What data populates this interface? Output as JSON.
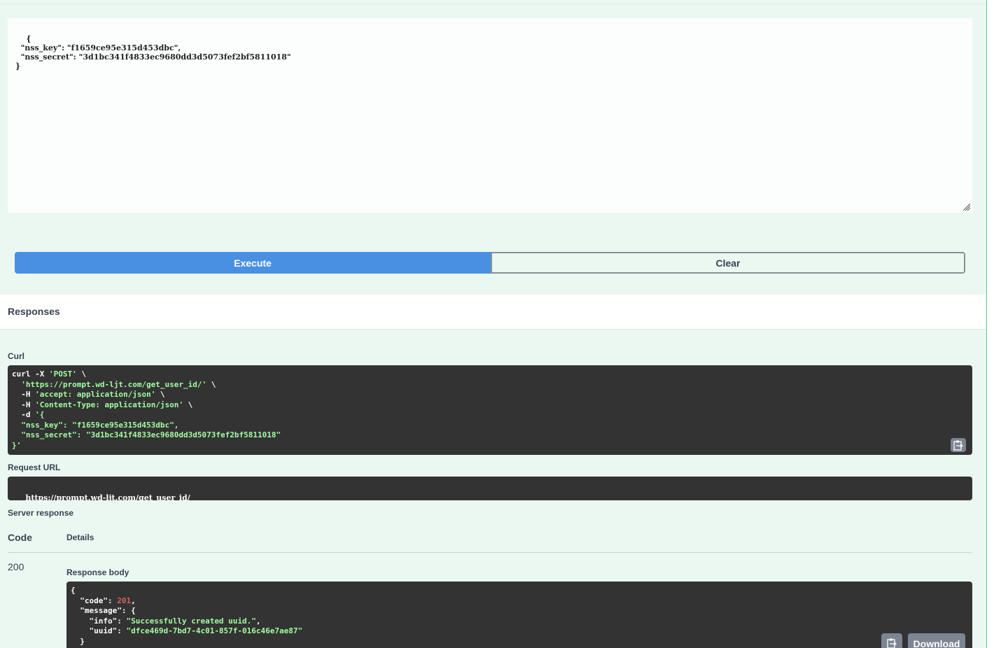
{
  "request_body": {
    "text": "{\n  \"nss_key\": \"f1659ce95e315d453dbc\",\n  \"nss_secret\": \"3d1bc341f4833ec9680dd3d5073fef2bf5811018\"\n}"
  },
  "buttons": {
    "execute": "Execute",
    "clear": "Clear"
  },
  "responses": {
    "title": "Responses",
    "curl_label": "Curl",
    "curl_lines": [
      {
        "w": "curl -X ",
        "g": "'POST'",
        "t": " \\"
      },
      {
        "w": "  ",
        "g": "'https://prompt.wd-ljt.com/get_user_id/'",
        "t": " \\"
      },
      {
        "w": "  -H ",
        "g": "'accept: application/json'",
        "t": " \\"
      },
      {
        "w": "  -H ",
        "g": "'Content-Type: application/json'",
        "t": " \\"
      },
      {
        "w": "  -d ",
        "g": "'{",
        "t": ""
      },
      {
        "w": "",
        "g": "  \"nss_key\": \"f1659ce95e315d453dbc\",",
        "t": ""
      },
      {
        "w": "",
        "g": "  \"nss_secret\": \"3d1bc341f4833ec9680dd3d5073fef2bf5811018\"",
        "t": ""
      },
      {
        "w": "",
        "g": "}'",
        "t": ""
      }
    ],
    "request_url_label": "Request URL",
    "request_url": "https://prompt.wd-ljt.com/get_user_id/",
    "server_response_label": "Server response",
    "code_header": "Code",
    "details_header": "Details",
    "status_code": "200",
    "response_body_label": "Response body",
    "response_body": {
      "code": "201",
      "info": "\"Successfully created uuid.\"",
      "uuid": "\"dfce469d-7bd7-4c01-857f-016c46e7ae87\""
    },
    "download_label": "Download"
  }
}
